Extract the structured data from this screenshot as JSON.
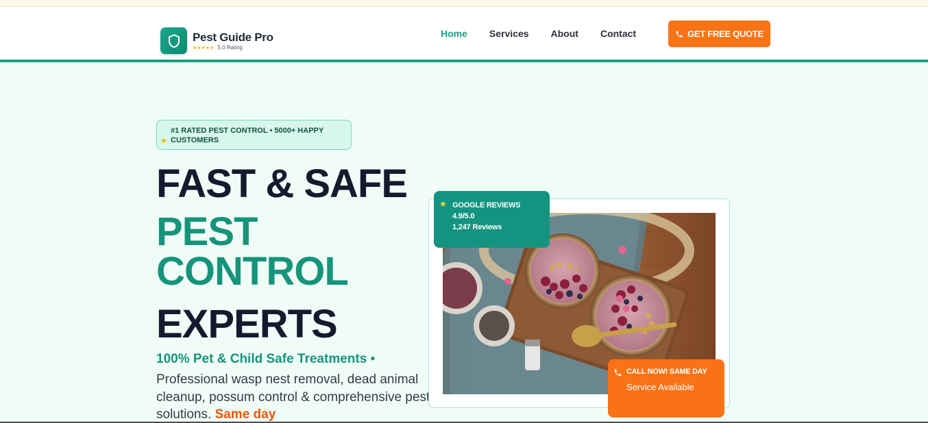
{
  "brand": {
    "name": "Pest Guide Pro",
    "stars": "★★★★★",
    "rating": "5.0 Rating",
    "icon": "shield-icon"
  },
  "nav": {
    "items": [
      {
        "label": "Home",
        "active": true
      },
      {
        "label": "Services",
        "active": false
      },
      {
        "label": "About",
        "active": false
      },
      {
        "label": "Contact",
        "active": false
      }
    ]
  },
  "header": {
    "cta_label": "GET FREE QUOTE",
    "cta_icon": "phone-icon"
  },
  "hero": {
    "badge": "#1 RATED PEST CONTROL • 5000+ HAPPY CUSTOMERS",
    "headline_1": "FAST & SAFE",
    "headline_2": "PEST",
    "headline_3": "CONTROL",
    "headline_4": "EXPERTS",
    "safe_line": "100% Pet & Child Safe Treatments •",
    "description": "Professional wasp nest removal, dead animal cleanup, possum control & comprehensive pest solutions.",
    "description_highlight": "Same day"
  },
  "reviews_card": {
    "title": "GOOGLE REVIEWS",
    "score": "4.9/5.0",
    "count": "1,247 Reviews"
  },
  "call_card": {
    "title": "CALL NOW! SAME DAY",
    "subtitle": "Service Available"
  },
  "colors": {
    "primary": "#16a085",
    "accent": "#f97316",
    "dark": "#141b2d",
    "background": "#f0fdf7"
  }
}
